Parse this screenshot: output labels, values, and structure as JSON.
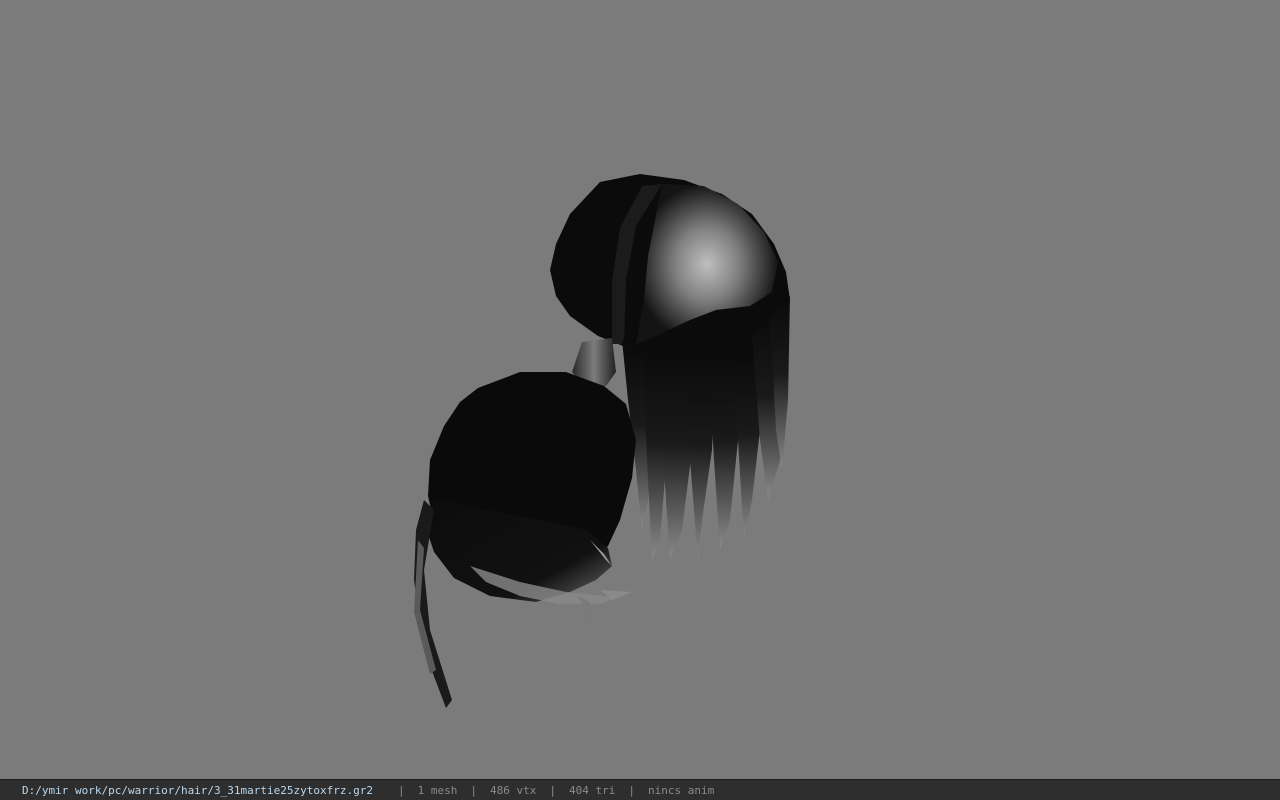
{
  "viewport": {
    "background_color": "#7b7b7b",
    "model": "hair-mesh"
  },
  "status_bar": {
    "file_path": "D:/ymir work/pc/warrior/hair/3_31martie25zytoxfrz.gr2",
    "separator": "|",
    "mesh_count": "1 mesh",
    "vertex_count": "486 vtx",
    "triangle_count": "404 tri",
    "anim_status": "nincs anim",
    "path_color": "#b9d7ee",
    "stat_color": "#8a8a8a"
  }
}
